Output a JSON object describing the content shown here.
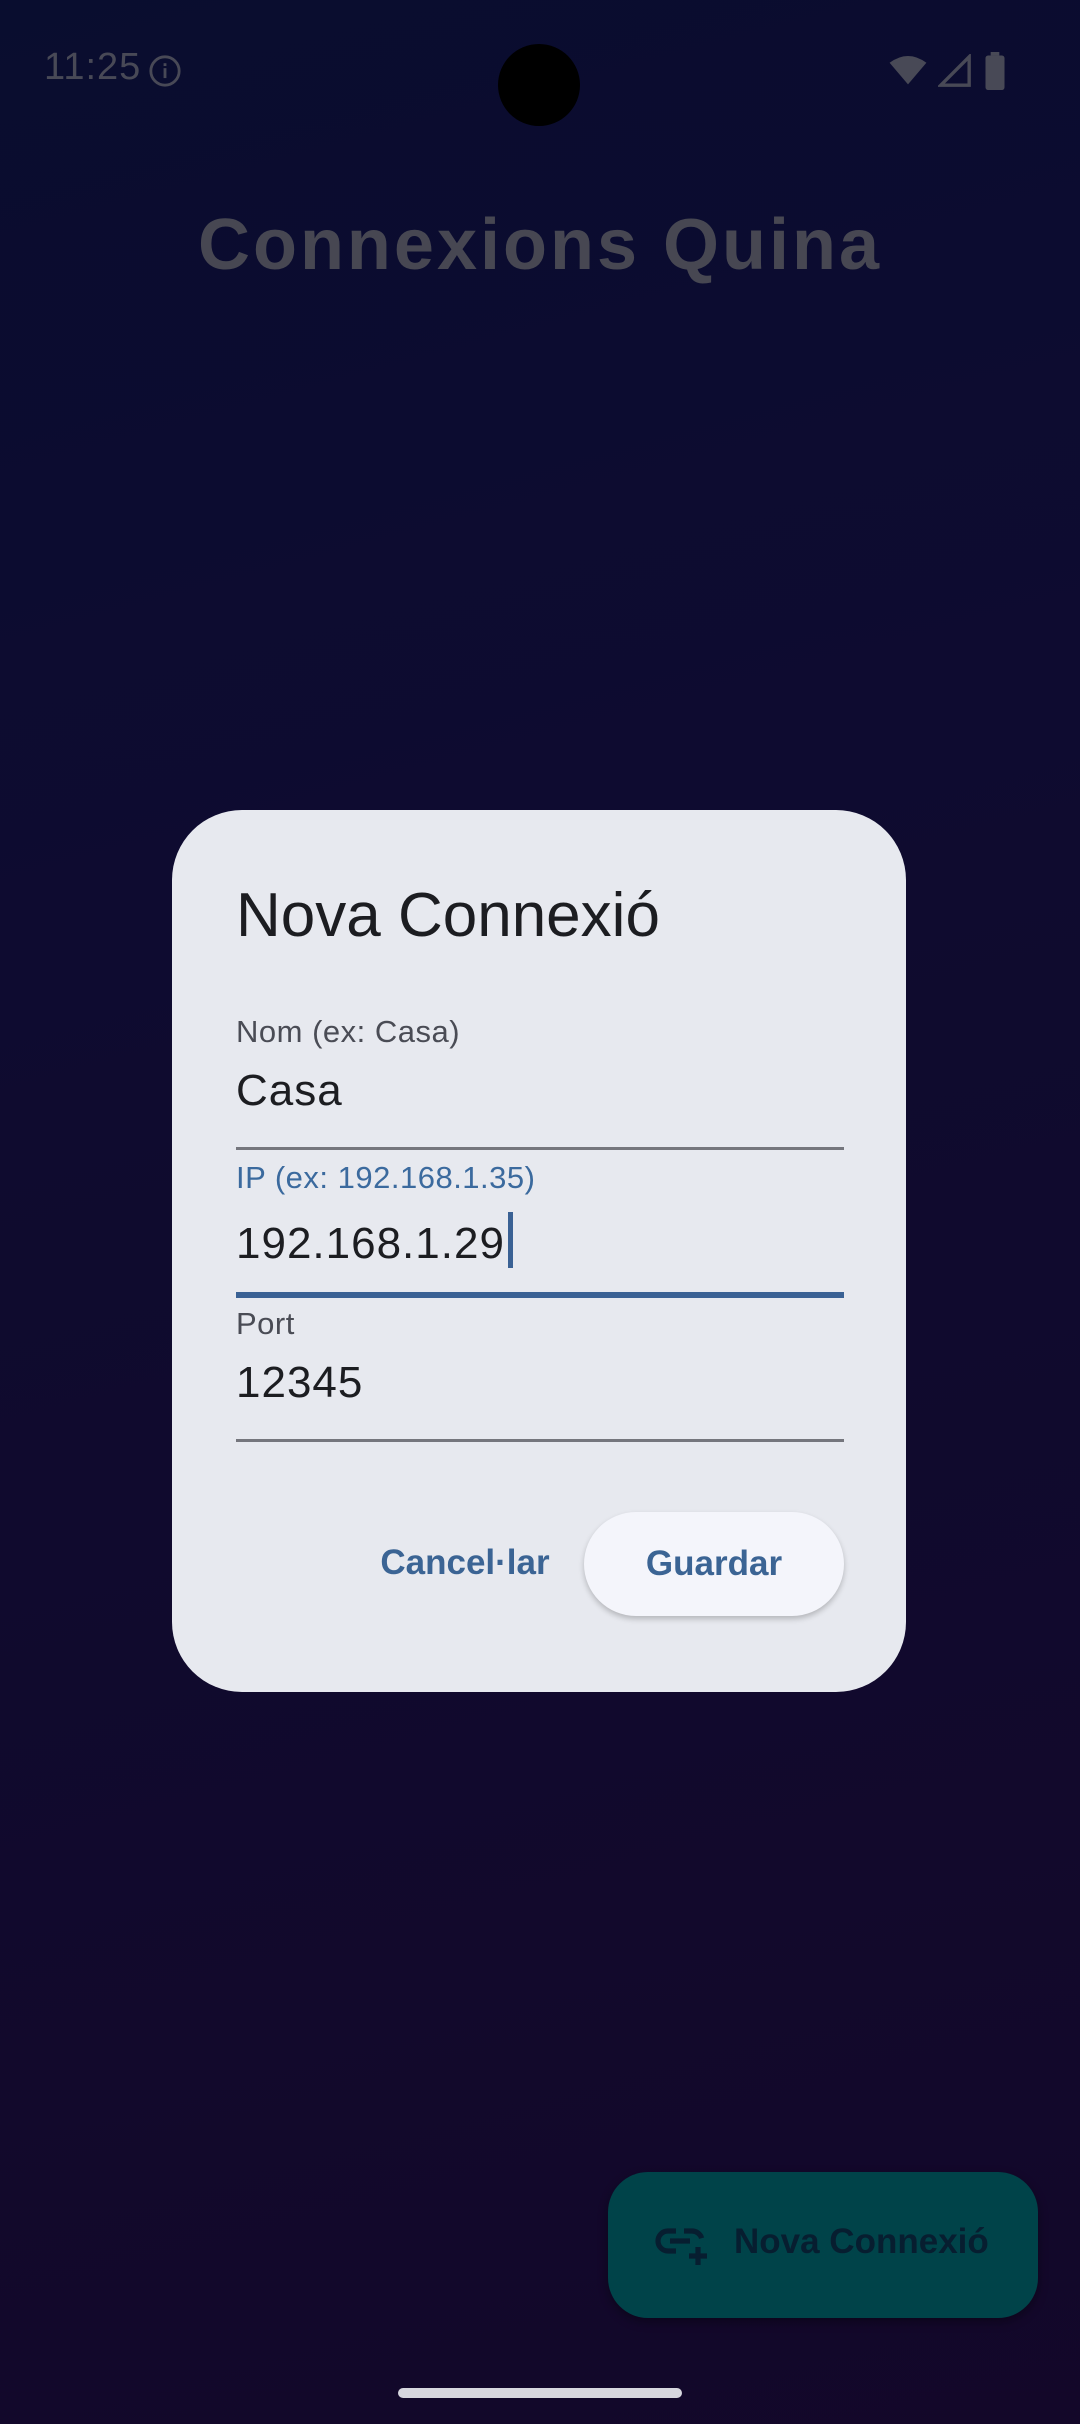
{
  "status_bar": {
    "time": "11:25"
  },
  "app": {
    "title": "Connexions Quina"
  },
  "dialog": {
    "title": "Nova Connexió",
    "fields": [
      {
        "label": "Nom (ex: Casa)",
        "value": "Casa"
      },
      {
        "label": "IP (ex: 192.168.1.35)",
        "value": "192.168.1.29"
      },
      {
        "label": "Port",
        "value": "12345"
      }
    ],
    "cancel_label": "Cancel·lar",
    "save_label": "Guardar"
  },
  "fab": {
    "label": "Nova Connexió",
    "icon": "add-link-icon"
  },
  "colors": {
    "accent": "#3a6194",
    "fab_background": "#006770",
    "dialog_background": "#e7e9ef"
  }
}
